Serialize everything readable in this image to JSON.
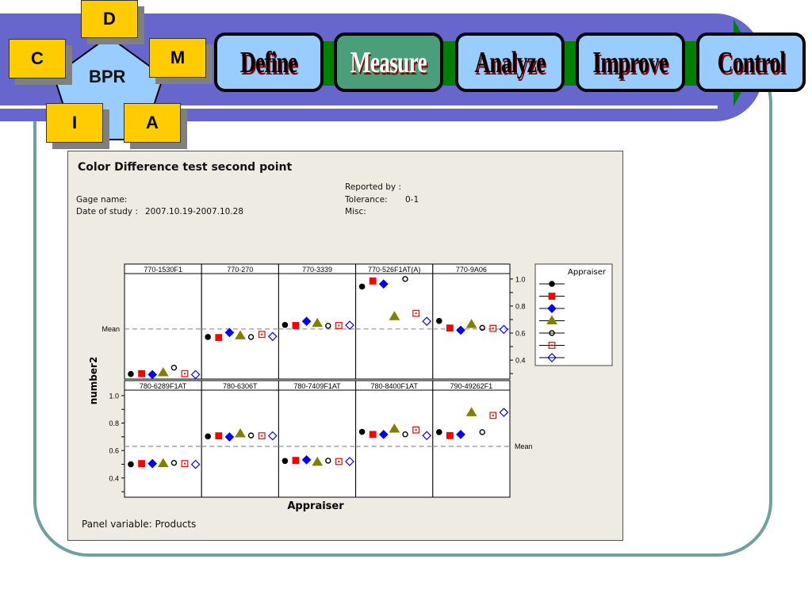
{
  "nav": {
    "center": "BPR",
    "letters": [
      "D",
      "M",
      "A",
      "I",
      "C"
    ],
    "steps": [
      "Define",
      "Measure",
      "Analyze",
      "Improve",
      "Control"
    ],
    "active": "Measure"
  },
  "report": {
    "title": "Color Difference test second point",
    "gage_name_label": "Gage name:",
    "date_label": "Date of study :",
    "date_value": "2007.10.19-2007.10.28",
    "reported_by_label": "Reported by :",
    "tolerance_label": "Tolerance:",
    "tolerance_value": "0-1",
    "misc_label": "Misc:",
    "panel_variable": "Panel variable: Products"
  },
  "chart_data": {
    "type": "scatter",
    "ylabel": "number2",
    "xlabel": "Appraiser",
    "legend_title": "Appraiser",
    "legend_placement": "right",
    "mean": 0.63,
    "mean_label": "Mean",
    "ylim": [
      0.26,
      1.04
    ],
    "yticks": [
      0.4,
      0.6,
      0.8,
      1.0
    ],
    "ytick_labels": [
      "0.4",
      "0.6",
      "0.8",
      "1.0"
    ],
    "markers": [
      {
        "shape": "circle",
        "fill": true,
        "color": "#000000"
      },
      {
        "shape": "square",
        "fill": true,
        "color": "#ff0000"
      },
      {
        "shape": "diamond",
        "fill": true,
        "color": "#0000ff"
      },
      {
        "shape": "triangle",
        "fill": true,
        "color": "#808000"
      },
      {
        "shape": "circle",
        "fill": false,
        "color": "#000000"
      },
      {
        "shape": "square",
        "fill": false,
        "color": "#ff0000"
      },
      {
        "shape": "diamond",
        "fill": false,
        "color": "#0000ff"
      }
    ],
    "panels": [
      {
        "product": "770-1530F1",
        "values": [
          0.297,
          0.3,
          0.293,
          0.307,
          0.344,
          0.3,
          0.293
        ]
      },
      {
        "product": "770-270",
        "values": [
          0.571,
          0.567,
          0.604,
          0.58,
          0.571,
          0.59,
          0.575
        ]
      },
      {
        "product": "770-3339",
        "values": [
          0.66,
          0.656,
          0.687,
          0.672,
          0.654,
          0.656,
          0.658
        ]
      },
      {
        "product": "770-526F1AT(A)",
        "values": [
          0.944,
          0.985,
          0.963,
          0.722,
          1.0,
          0.746,
          0.687
        ]
      },
      {
        "product": "770-9A06",
        "values": [
          0.69,
          0.637,
          0.621,
          0.664,
          0.639,
          0.635,
          0.627
        ]
      },
      {
        "product": "780-6289F1AT",
        "values": [
          0.5,
          0.505,
          0.505,
          0.505,
          0.51,
          0.505,
          0.499
        ]
      },
      {
        "product": "780-6306T",
        "values": [
          0.703,
          0.707,
          0.699,
          0.722,
          0.71,
          0.707,
          0.707
        ]
      },
      {
        "product": "780-7409F1AT",
        "values": [
          0.524,
          0.528,
          0.532,
          0.515,
          0.526,
          0.52,
          0.52
        ]
      },
      {
        "product": "780-8400F1AT",
        "values": [
          0.736,
          0.717,
          0.717,
          0.757,
          0.718,
          0.75,
          0.709
        ]
      },
      {
        "product": "790-49262F1",
        "values": [
          0.734,
          0.709,
          0.717,
          0.876,
          0.734,
          0.856,
          0.878
        ]
      }
    ]
  }
}
